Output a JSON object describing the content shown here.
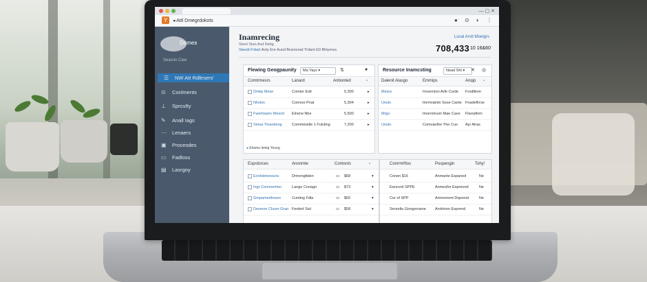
{
  "browser": {
    "address_text": "Attl Dmegrdokots",
    "app_logo_glyph": "Y"
  },
  "sidebar": {
    "brand": "Domes",
    "subtitle": "Seasrio Ciee",
    "items": [
      {
        "icon": "users-icon",
        "label": "NW Att Rdltrsers'",
        "active": true
      },
      {
        "icon": "comments-icon",
        "label": "Conlments"
      },
      {
        "icon": "security-icon",
        "label": "Sprcufty"
      },
      {
        "icon": "logs-icon",
        "label": "Anall Iags"
      },
      {
        "icon": "lenses-icon",
        "label": "Lenaers"
      },
      {
        "icon": "processes-icon",
        "label": "Procesdes"
      },
      {
        "icon": "folders-icon",
        "label": "Fadloss"
      },
      {
        "icon": "library-icon",
        "label": "Lasrgoy"
      }
    ]
  },
  "header": {
    "title": "Inamrecing",
    "sub1": "Steet Stan Avd   Retig",
    "sub2_link": "Steedi Frtiart",
    "sub2_text": "Aoty Ere Aund Bramorad Trdant E0 Bhtyrnes",
    "right_links": "Lsoal   Arstt Moeigrs",
    "big_number": "708,433",
    "big_unit": "10 16&60"
  },
  "panel1": {
    "title": "Flewing Geogpaunity",
    "select": "Ma Yays",
    "columns": [
      "Comtrmesrs",
      "Lanard",
      "Anbonted"
    ],
    "rows": [
      {
        "name": "Dmkp Mesn",
        "col2": "Comtor Eslt",
        "value": "5,300"
      },
      {
        "name": "Nhslon",
        "col2": "Comnor Pnat",
        "value": "5,304"
      },
      {
        "name": "Fwerhawm Weech",
        "col2": "Elnerw Nhe",
        "value": "5,500"
      },
      {
        "name": "Smea Yinarsleng",
        "col2": "Commeisitle 1 Fulcting",
        "value": "7,200"
      }
    ],
    "footer": "Ehsmu Ieinig Young"
  },
  "panel2": {
    "title": "Resource Inamcsting",
    "select": "Nead Sht",
    "columns": [
      "Dalenit Alasgo",
      "Emmips",
      "Anqip"
    ],
    "rows": [
      {
        "name": "Mesro",
        "col2": "Irnvernton Arfe Cunle",
        "col3": "Frodtlinm"
      },
      {
        "name": "Unslo",
        "col2": "Imrmratntn Sose Cante",
        "col3": "Fnadeflrrse"
      },
      {
        "name": "Mrgo",
        "col2": "Imornrtnum Mae Cave",
        "col3": "Flarrafinm"
      },
      {
        "name": "Unsto",
        "col2": "Comvanthe Yhe Cuo",
        "col3": "Ayr Alras"
      }
    ]
  },
  "panel3": {
    "columns": [
      "Esprdsrces",
      "Anonmte",
      "Contonts"
    ],
    "rows": [
      {
        "name": "Eonlsletsnouns",
        "col2": "Dmrengttden",
        "value": "$68"
      },
      {
        "name": "Ingr Commertion",
        "col2": "Lange Conago",
        "value": "$73"
      },
      {
        "name": "Gmpamedlrsses",
        "col2": "Cunting Fdla",
        "value": "$50"
      },
      {
        "name": "Desmon Clusm Gran",
        "col2": "Ferded Sisl",
        "value": "$58"
      }
    ]
  },
  "panel4": {
    "columns": [
      "Conrmrtfios",
      "Pospengin",
      "Tohy!"
    ],
    "rows": [
      {
        "name": "Conen $16",
        "col2": "Anmante Espaned",
        "col3": "Ne"
      },
      {
        "name": "Eancord SPPE",
        "col2": "Anmesfor Espreond",
        "col3": "Ne"
      },
      {
        "name": "Cor of SPP",
        "col2": "Armnonent Dsprend",
        "col3": "Ne"
      },
      {
        "name": "Senreltu Gongerrame",
        "col2": "Andrinon Eoprend",
        "col3": "Ne"
      }
    ]
  },
  "colors": {
    "sidebar_bg": "#4a5a6c",
    "active_item": "#2f78b7",
    "link": "#2f6fb0",
    "logo_orange": "#e47a27"
  }
}
